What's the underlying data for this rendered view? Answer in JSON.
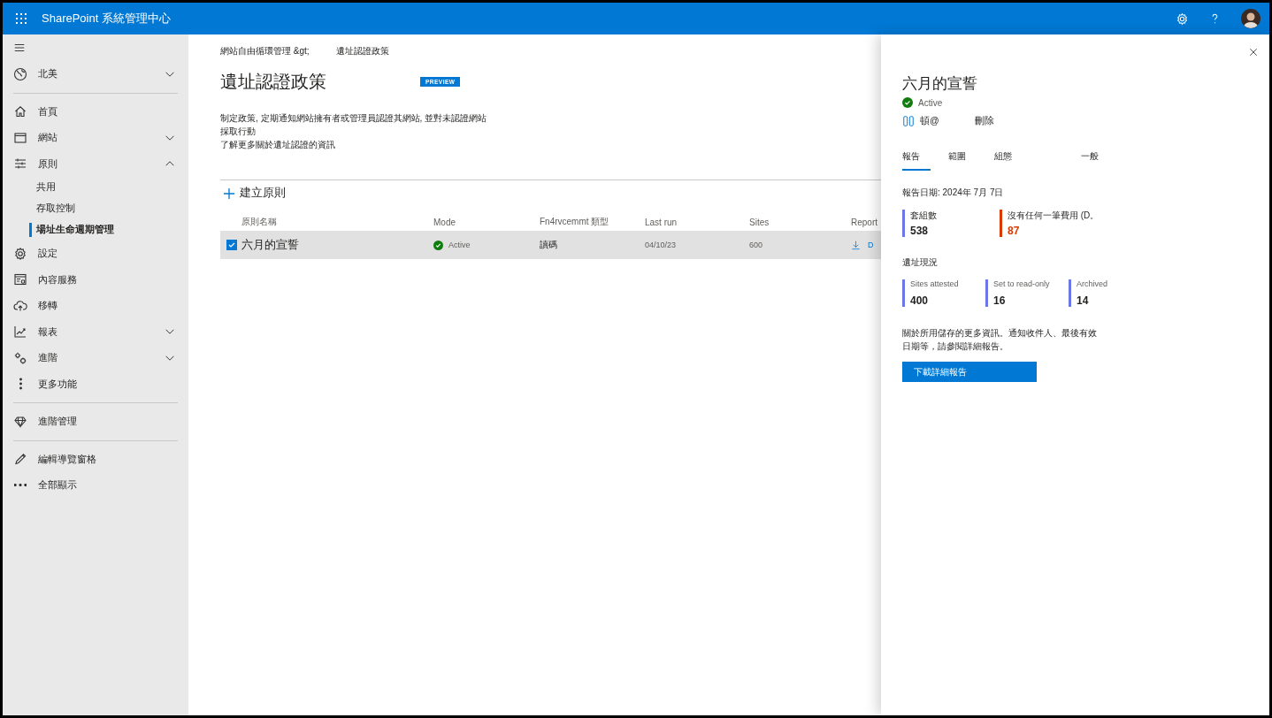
{
  "app": {
    "title": "SharePoint 系統管理中心"
  },
  "sidebar": {
    "groups": [
      {
        "items": [
          {
            "label": "北美",
            "expanded": false
          }
        ]
      },
      {
        "items": [
          {
            "label": "首頁"
          },
          {
            "label": "網站",
            "expanded": false
          },
          {
            "label": "原則",
            "expanded": true,
            "children": [
              {
                "label": "共用",
                "selected": false
              },
              {
                "label": "存取控制",
                "selected": false
              },
              {
                "label": "場址生命週期管理",
                "selected": true
              }
            ]
          },
          {
            "label": "設定"
          },
          {
            "label": "內容服務"
          },
          {
            "label": "移轉"
          },
          {
            "label": "報表",
            "expanded": false
          },
          {
            "label": "進階",
            "expanded": false
          },
          {
            "label": "更多功能"
          }
        ]
      },
      {
        "items": [
          {
            "label": "進階管理"
          }
        ]
      },
      {
        "items": [
          {
            "label": "編輯導覽窗格"
          },
          {
            "label": "全部顯示"
          }
        ]
      }
    ]
  },
  "main": {
    "breadcrumb": [
      "網站自由循環管理 &gt;",
      "遺址認證政策"
    ],
    "title": "遺址認證政策",
    "badge": "PREVIEW",
    "description": "制定政策, 定期通知網站擁有者或管理員認證其網站, 並對未認證網站採取行動",
    "link": "了解更多關於遺址認證的資訊",
    "new_button": "建立原則",
    "table": {
      "columns": [
        "原則名稱",
        "Mode",
        "Fn4rvcemmt 類型",
        "Last run",
        "Sites",
        "Report"
      ],
      "rows": [
        {
          "selected": true,
          "name": "六月的宣誓",
          "mode": "Active",
          "type": "讀碼",
          "last_run": "04/10/23",
          "sites": "600",
          "report": "D"
        }
      ]
    }
  },
  "panel": {
    "title": "六月的宣誓",
    "status": "Active",
    "actions": [
      "頓@",
      "刪除"
    ],
    "tabs": [
      {
        "label": "報告",
        "selected": true
      },
      {
        "label": "範圍",
        "selected": false
      },
      {
        "label": "組態",
        "selected": false
      },
      {
        "label": "一般",
        "selected": false
      }
    ],
    "report_date": "報告日期: 2024年 7月 7日",
    "metrics": [
      {
        "label": "套組數",
        "value": "538",
        "color": "#6b76e8",
        "alert": false
      },
      {
        "label": "沒有任何一筆費用 (D。",
        "value": "87",
        "color": "#d83b01",
        "alert": true
      }
    ],
    "section": "遺址現況",
    "status_metrics": [
      {
        "label": "Sites attested",
        "value": "400",
        "color": "#6b76e8"
      },
      {
        "label": "Set to read-only",
        "value": "16",
        "color": "#6b76e8"
      },
      {
        "label": "Archived",
        "value": "14",
        "color": "#6b76e8"
      }
    ],
    "note": "關於所用儲存的更多資訊。通知收件人、最後有效日期等，請參閱詳細報告。",
    "download_button": "下載詳細報告"
  }
}
